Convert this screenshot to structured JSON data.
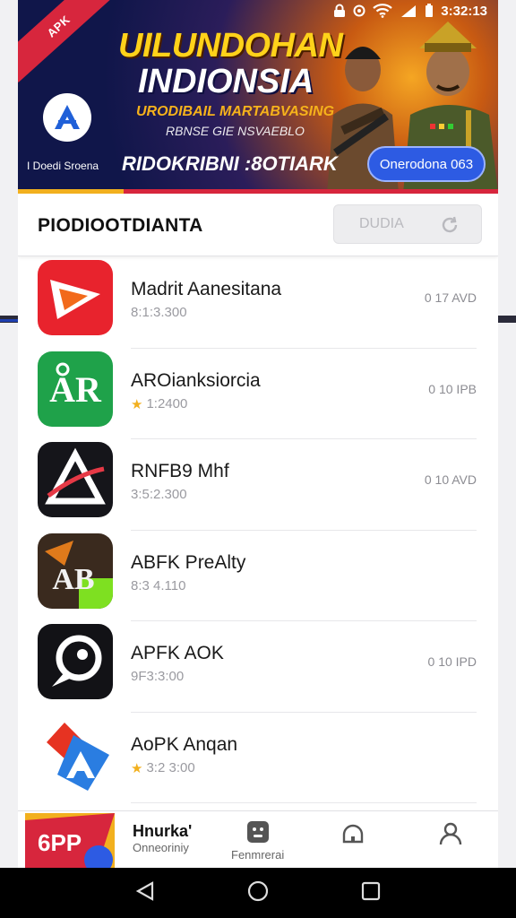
{
  "status_bar": {
    "time": "3:32:13"
  },
  "banner": {
    "ribbon": "APK",
    "title_line1": "UILUNDOHAN",
    "title_line2": "INDIONSIA",
    "subtitle1": "URODIBAIL MARTABVASING",
    "subtitle2": "RBNSE GIE NSVAEBLO",
    "small_text": "I Doedi Sroena",
    "promo_text": "RIDOKRIBNI :8OTIARK",
    "cta_label": "Onerodona 063",
    "accent_colors": [
      "#f2b01e",
      "#d7263d",
      "#2d5be3"
    ]
  },
  "list_header": {
    "title": "PIODIOOTDIANTA",
    "button_label": "DUDIA"
  },
  "apps": [
    {
      "name": "Madrit Aanesitana",
      "sub": "8:1:3.300",
      "size": "0 17 AVD",
      "rated": false,
      "icon": "play-arrow-icon"
    },
    {
      "name": "AROianksiorcia",
      "sub": "1:2400",
      "size": "0 10 IPB",
      "rated": true,
      "icon": "ar-logo-icon"
    },
    {
      "name": "RNFB9 Mhf",
      "sub": "3:5:2.300",
      "size": "0 10 AVD",
      "rated": false,
      "icon": "delta-logo-icon"
    },
    {
      "name": "ABFK PreAlty",
      "sub": "8:3 4.110",
      "size": "",
      "rated": false,
      "icon": "ab-logo-icon"
    },
    {
      "name": "APFK AOK",
      "sub": "9F3:3:00",
      "size": "0 10 IPD",
      "rated": false,
      "icon": "chat-bubble-icon"
    },
    {
      "name": "AoPK Anqan",
      "sub": "3:2 3:00",
      "size": "",
      "rated": true,
      "icon": "a-store-icon"
    }
  ],
  "bottom_nav": {
    "thumb_text": "6PP",
    "title": "Hnurka'",
    "title_sub": "Onneoriniy",
    "tab2": "Fenmrerai"
  }
}
